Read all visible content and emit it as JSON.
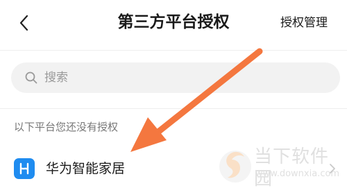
{
  "header": {
    "title": "第三方平台授权",
    "manage_label": "授权管理",
    "back_icon": "chevron-left-icon"
  },
  "search": {
    "placeholder": "搜索",
    "icon": "search-icon"
  },
  "section": {
    "label": "以下平台您还没有授权"
  },
  "apps": [
    {
      "name": "华为智能家居",
      "icon": "huawei-smart-home-icon",
      "icon_color": "#1f8cf0"
    }
  ],
  "annotation": {
    "arrow_color": "#f4773f"
  },
  "watermark": {
    "text": "当下软件园",
    "url": "www.downxia.com"
  }
}
